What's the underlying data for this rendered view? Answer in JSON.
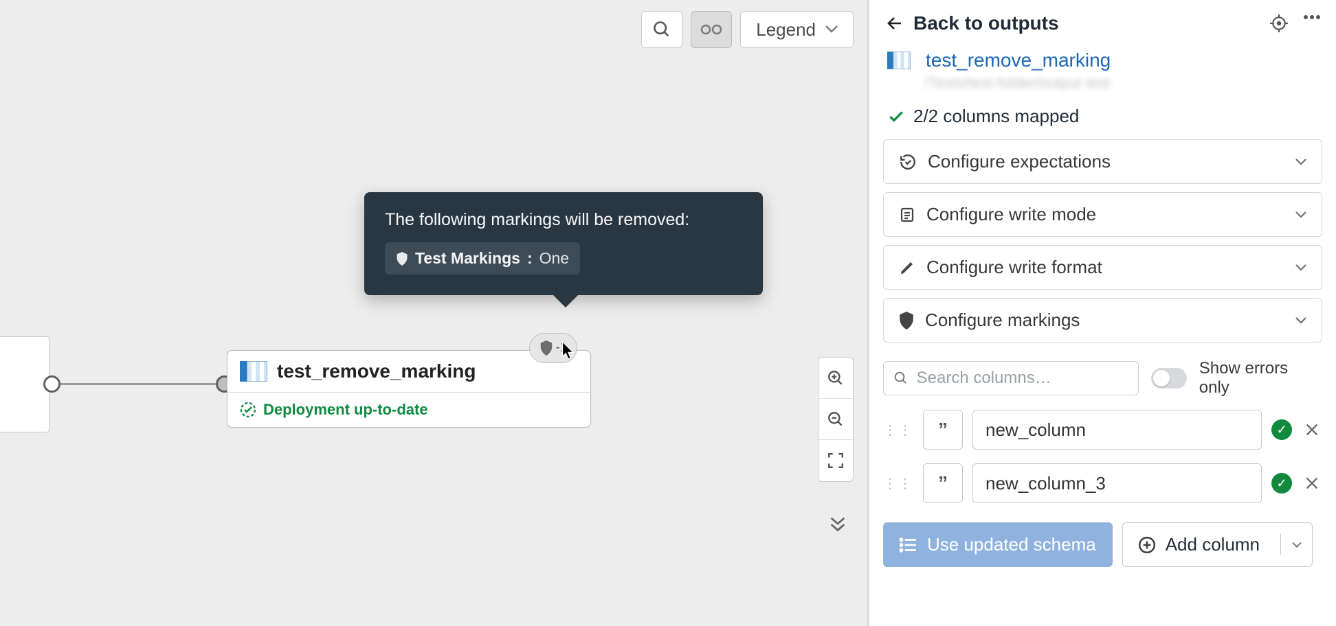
{
  "toolbar": {
    "legend_label": "Legend"
  },
  "tooltip": {
    "title": "The following markings will be removed:",
    "marking_group": "Test Markings",
    "marking_value": "One",
    "badge_count": "-1"
  },
  "node": {
    "title": "test_remove_marking",
    "status": "Deployment up-to-date"
  },
  "side": {
    "back_label": "Back to outputs",
    "dataset_name": "test_remove_marking",
    "dataset_path": "/Tests/test-folder/output test",
    "columns_mapped": "2/2 columns mapped",
    "config_items": [
      "Configure expectations",
      "Configure write mode",
      "Configure write format",
      "Configure markings"
    ],
    "search_placeholder": "Search columns…",
    "show_errors_label": "Show errors only",
    "columns": [
      "new_column",
      "new_column_3"
    ],
    "use_updated_label": "Use updated schema",
    "add_column_label": "Add column"
  }
}
